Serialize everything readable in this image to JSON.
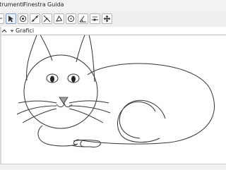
{
  "menu": {
    "items": [
      "Strumenti",
      "Finestra",
      "Guida"
    ]
  },
  "toolbar": {
    "tools": [
      {
        "name": "partial-tool-icon",
        "active": false
      },
      {
        "name": "move-arrow-tool-icon",
        "active": true
      },
      {
        "name": "point-tool-icon",
        "active": false
      },
      {
        "name": "line-tool-icon",
        "active": false
      },
      {
        "name": "perpendicular-line-tool-icon",
        "active": false
      },
      {
        "name": "polygon-tool-icon",
        "active": false
      },
      {
        "name": "circle-tool-icon",
        "active": false
      },
      {
        "name": "angle-tool-icon",
        "active": false
      },
      {
        "name": "slider-tool-icon",
        "active": false
      },
      {
        "name": "move-view-tool-icon",
        "active": false
      }
    ]
  },
  "panel": {
    "title": "Grafici"
  },
  "colors": {
    "toolbar_bg": "#efefef",
    "active_tool_border": "#7a9cc6",
    "stroke": "#333333",
    "nose_fill": "#9e9e9e"
  }
}
